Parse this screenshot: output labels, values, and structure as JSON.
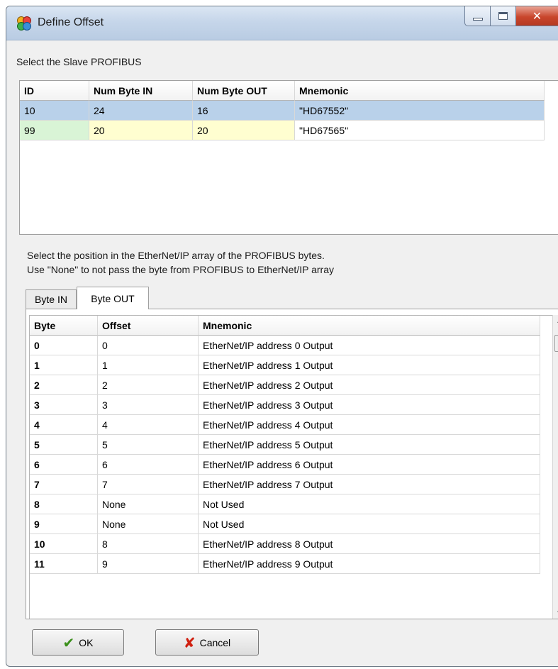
{
  "window": {
    "title": "Define Offset",
    "close_glyph": "✕"
  },
  "slave_section": {
    "label": "Select the Slave PROFIBUS",
    "columns": [
      "ID",
      "Num Byte IN",
      "Num Byte OUT",
      "Mnemonic"
    ],
    "rows": [
      {
        "id": "10",
        "num_in": "24",
        "num_out": "16",
        "mnemonic": "\"HD67552\""
      },
      {
        "id": "99",
        "num_in": "20",
        "num_out": "20",
        "mnemonic": "\"HD67565\""
      }
    ],
    "selected_row": 0
  },
  "instructions": {
    "line1": "Select the position in the EtherNet/IP array of the PROFIBUS bytes.",
    "line2": "Use \"None\" to not pass the byte from PROFIBUS to EtherNet/IP array"
  },
  "tabs": [
    {
      "label": "Byte IN",
      "active": false
    },
    {
      "label": "Byte OUT",
      "active": true
    }
  ],
  "byte_table": {
    "columns": [
      "Byte",
      "Offset",
      "Mnemonic"
    ],
    "rows": [
      {
        "byte": "0",
        "offset": "0",
        "mnemonic": "EtherNet/IP address 0 Output"
      },
      {
        "byte": "1",
        "offset": "1",
        "mnemonic": "EtherNet/IP address 1 Output"
      },
      {
        "byte": "2",
        "offset": "2",
        "mnemonic": "EtherNet/IP address 2 Output"
      },
      {
        "byte": "3",
        "offset": "3",
        "mnemonic": "EtherNet/IP address 3 Output"
      },
      {
        "byte": "4",
        "offset": "4",
        "mnemonic": "EtherNet/IP address 4 Output"
      },
      {
        "byte": "5",
        "offset": "5",
        "mnemonic": "EtherNet/IP address 5 Output"
      },
      {
        "byte": "6",
        "offset": "6",
        "mnemonic": "EtherNet/IP address 6 Output"
      },
      {
        "byte": "7",
        "offset": "7",
        "mnemonic": "EtherNet/IP address 7 Output"
      },
      {
        "byte": "8",
        "offset": "None",
        "mnemonic": "Not Used"
      },
      {
        "byte": "9",
        "offset": "None",
        "mnemonic": "Not Used"
      },
      {
        "byte": "10",
        "offset": "8",
        "mnemonic": "EtherNet/IP address 8 Output"
      },
      {
        "byte": "11",
        "offset": "9",
        "mnemonic": "EtherNet/IP address 9 Output"
      }
    ]
  },
  "buttons": {
    "ok_label": "OK",
    "cancel_label": "Cancel"
  },
  "icons": {
    "title": "app-icon",
    "ok": "checkmark-icon",
    "cancel": "red-x-icon"
  },
  "colors": {
    "selected_row": "#b9d1ea",
    "alt_row": "#fffed0",
    "alt_id_cell": "#d9f4d6",
    "close_button": "#c9462c"
  }
}
